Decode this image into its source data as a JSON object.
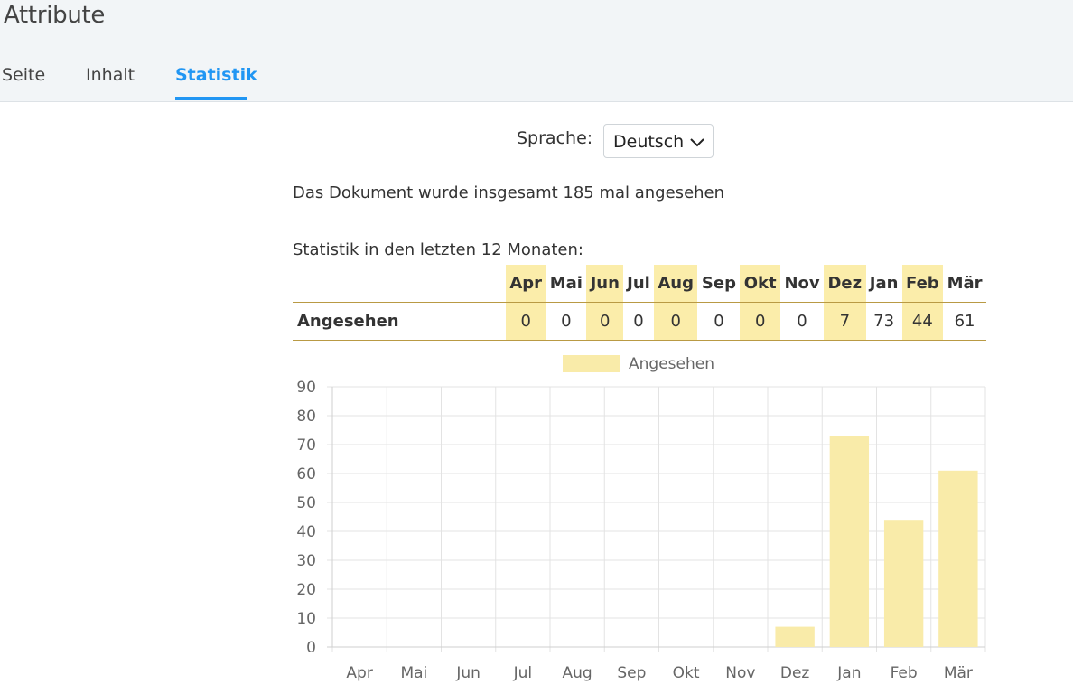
{
  "header": {
    "title": "Attribute",
    "tabs": [
      {
        "label": "Seite",
        "active": false
      },
      {
        "label": "Inhalt",
        "active": false
      },
      {
        "label": "Statistik",
        "active": true
      }
    ]
  },
  "language": {
    "label": "Sprache:",
    "value": "Deutsch"
  },
  "summary": {
    "total_text": "Das Dokument wurde insgesamt 185 mal angesehen"
  },
  "table": {
    "caption": "Statistik in den letzten 12 Monaten:",
    "row_label": "Angesehen",
    "months": [
      "Apr",
      "Mai",
      "Jun",
      "Jul",
      "Aug",
      "Sep",
      "Okt",
      "Nov",
      "Dez",
      "Jan",
      "Feb",
      "Mär"
    ],
    "values": [
      0,
      0,
      0,
      0,
      0,
      0,
      0,
      0,
      7,
      73,
      44,
      61
    ]
  },
  "colors": {
    "accent": "#2196f3",
    "highlight": "#fbedaa",
    "bar": "#f9eba9"
  },
  "chart_data": {
    "type": "bar",
    "categories": [
      "Apr",
      "Mai",
      "Jun",
      "Jul",
      "Aug",
      "Sep",
      "Okt",
      "Nov",
      "Dez",
      "Jan",
      "Feb",
      "Mär"
    ],
    "series": [
      {
        "name": "Angesehen",
        "values": [
          0,
          0,
          0,
          0,
          0,
          0,
          0,
          0,
          7,
          73,
          44,
          61
        ]
      }
    ],
    "ylim": [
      0,
      90
    ],
    "yticks": [
      0,
      10,
      20,
      30,
      40,
      50,
      60,
      70,
      80,
      90
    ],
    "grid": true,
    "legend": "top-center"
  }
}
